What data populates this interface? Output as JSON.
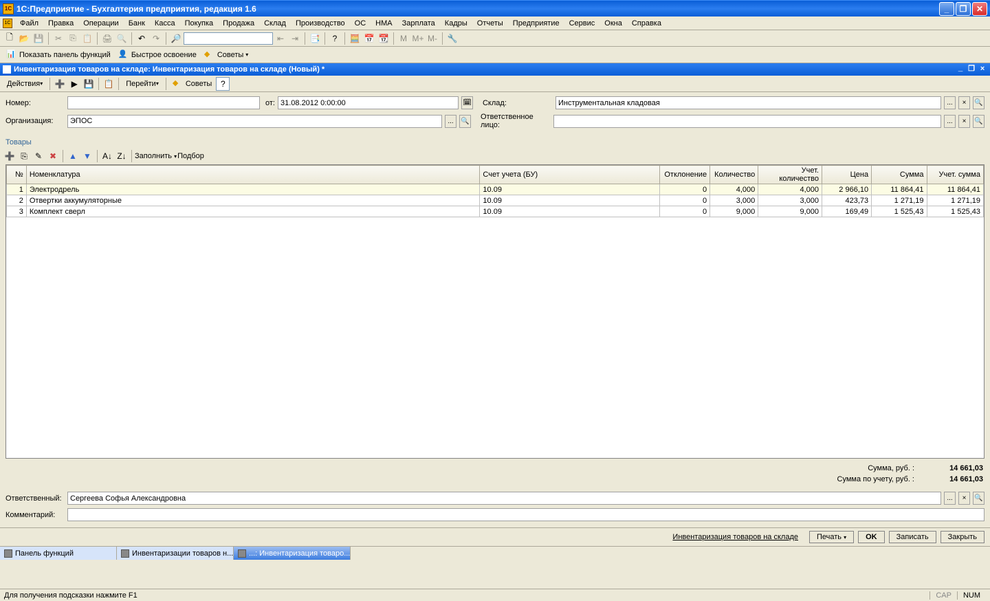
{
  "title": "1С:Предприятие  - Бухгалтерия предприятия, редакция 1.6",
  "main_menu": [
    "Файл",
    "Правка",
    "Операции",
    "Банк",
    "Касса",
    "Покупка",
    "Продажа",
    "Склад",
    "Производство",
    "ОС",
    "НМА",
    "Зарплата",
    "Кадры",
    "Отчеты",
    "Предприятие",
    "Сервис",
    "Окна",
    "Справка"
  ],
  "toolbar2": {
    "show_panel": "Показать панель функций",
    "quick": "Быстрое освоение",
    "tips": "Советы"
  },
  "doc": {
    "title": "Инвентаризация товаров на складе: Инвентаризация товаров на складе (Новый) *",
    "actions": "Действия",
    "goto": "Перейти",
    "tips": "Советы"
  },
  "fields": {
    "number_label": "Номер:",
    "number_value": "",
    "date_label": "от:",
    "date_value": "31.08.2012  0:00:00",
    "warehouse_label": "Склад:",
    "warehouse_value": "Инструментальная кладовая",
    "org_label": "Организация:",
    "org_value": "ЭПОС",
    "resp_label": "Ответственное лицо:",
    "resp_value": ""
  },
  "goods_section": "Товары",
  "table_toolbar": {
    "fill": "Заполнить",
    "select": "Подбор"
  },
  "table": {
    "headers": [
      "№",
      "Номенклатура",
      "Счет учета (БУ)",
      "Отклонение",
      "Количество",
      "Учет. количество",
      "Цена",
      "Сумма",
      "Учет. сумма"
    ],
    "rows": [
      {
        "n": "1",
        "nom": "Электродрель",
        "acc": "10.09",
        "dev": "0",
        "qty": "4,000",
        "aqty": "4,000",
        "price": "2 966,10",
        "sum": "11 864,41",
        "asum": "11 864,41"
      },
      {
        "n": "2",
        "nom": "Отвертки аккумуляторные",
        "acc": "10.09",
        "dev": "0",
        "qty": "3,000",
        "aqty": "3,000",
        "price": "423,73",
        "sum": "1 271,19",
        "asum": "1 271,19"
      },
      {
        "n": "3",
        "nom": "Комплект сверл",
        "acc": "10.09",
        "dev": "0",
        "qty": "9,000",
        "aqty": "9,000",
        "price": "169,49",
        "sum": "1 525,43",
        "asum": "1 525,43"
      }
    ]
  },
  "totals": {
    "sum_label": "Сумма, руб. :",
    "sum_value": "14 661,03",
    "asum_label": "Сумма по учету, руб. :",
    "asum_value": "14 661,03"
  },
  "bottom": {
    "resp_label": "Ответственный:",
    "resp_value": "Сергеева Софья Александровна",
    "comment_label": "Комментарий:",
    "comment_value": ""
  },
  "footer": {
    "info": "Инвентаризация товаров на складе",
    "print": "Печать",
    "ok": "OK",
    "save": "Записать",
    "close": "Закрыть"
  },
  "wnd_tabs": [
    {
      "label": "Панель функций",
      "active": false,
      "lite": true
    },
    {
      "label": "Инвентаризации товаров н...",
      "active": false,
      "lite": true
    },
    {
      "label": "...: Инвентаризация товаро...",
      "active": true
    }
  ],
  "status": {
    "text": "Для получения подсказки нажмите F1",
    "cap": "CAP",
    "num": "NUM"
  }
}
